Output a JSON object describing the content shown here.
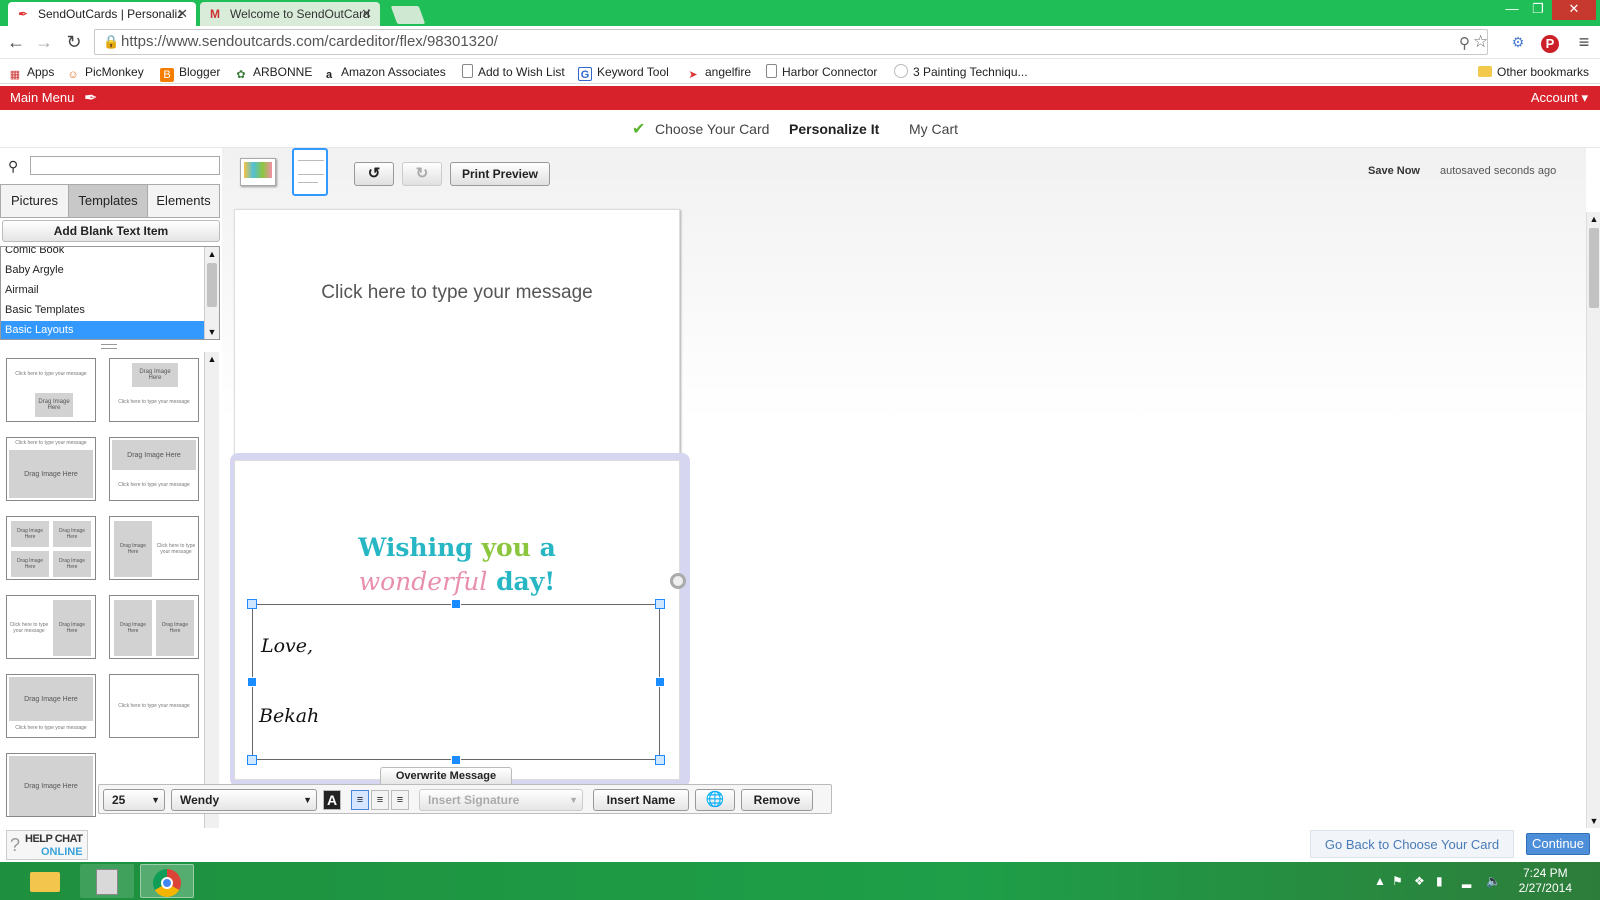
{
  "browser": {
    "tabs": [
      {
        "title": "SendOutCards | Personaliz",
        "active": true
      },
      {
        "title": "Welcome to SendOutCard",
        "active": false
      }
    ],
    "url": "https://www.sendoutcards.com/cardeditor/flex/98301320/",
    "bookmarks": [
      {
        "label": "Apps",
        "icon": "apps-grid-icon"
      },
      {
        "label": "PicMonkey",
        "icon": "picmonkey-icon"
      },
      {
        "label": "Blogger",
        "icon": "blogger-icon"
      },
      {
        "label": "ARBONNE",
        "icon": "arbonne-icon"
      },
      {
        "label": "Amazon Associates",
        "icon": "amazon-icon"
      },
      {
        "label": "Add to Wish List",
        "icon": "page-icon"
      },
      {
        "label": "Keyword Tool",
        "icon": "google-icon"
      },
      {
        "label": "angelfire",
        "icon": "angelfire-icon"
      },
      {
        "label": "Harbor Connector",
        "icon": "page-icon"
      },
      {
        "label": "3 Painting Techniqu...",
        "icon": "site-icon"
      }
    ],
    "other_bookmarks": "Other bookmarks"
  },
  "header": {
    "main_menu": "Main Menu",
    "account": "Account ▾",
    "steps": [
      "Choose Your Card",
      "Personalize It",
      "My Cart"
    ]
  },
  "left_panel": {
    "search_placeholder": "",
    "tabs": [
      "Pictures",
      "Templates",
      "Elements"
    ],
    "add_blank": "Add Blank Text Item",
    "categories": [
      "Comic Book",
      "Baby Argyle",
      "Airmail",
      "Basic Templates",
      "Basic Layouts"
    ],
    "selected_category": "Basic Layouts",
    "thumb_text": {
      "type_message": "Click here to type your message",
      "drag_image": "Drag Image Here"
    }
  },
  "editor": {
    "print_preview": "Print Preview",
    "save_now": "Save Now",
    "autosaved": "autosaved seconds ago",
    "top_message": "Click here to type your message",
    "headline_line1": [
      "Wishing ",
      "you",
      " a"
    ],
    "headline_line2": [
      "wonderful",
      " day!"
    ],
    "signature_line1": "Love,",
    "signature_line2": "Bekah",
    "overwrite": "Overwrite Message"
  },
  "text_tools": {
    "font_size": "25",
    "font_name": "Wendy",
    "insert_signature": "Insert Signature",
    "insert_name": "Insert Name",
    "remove": "Remove"
  },
  "footer": {
    "help_line1": "HELP CHAT",
    "help_line2": "ONLINE",
    "go_back": "Go Back to Choose Your Card",
    "continue": "Continue"
  },
  "taskbar": {
    "time": "7:24 PM",
    "date": "2/27/2014"
  },
  "colors": {
    "browser_green": "#1fbe56",
    "brand_red": "#d7222b",
    "selection_blue": "#3399ff",
    "headline_teal": "#27b6c4",
    "headline_green": "#8cc63f",
    "headline_pink": "#e88fae"
  }
}
